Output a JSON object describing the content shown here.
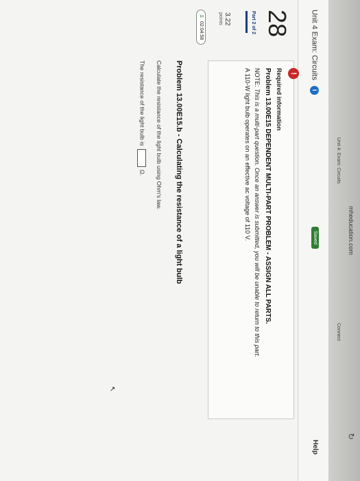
{
  "browser": {
    "url": "mheducation.com",
    "tabs": [
      "Unit 4: Exam: Circuits",
      "Connect"
    ]
  },
  "header": {
    "exam_title": "Unit 4 Exam: Circuits",
    "info_icon": "i",
    "saved_label": "Saved",
    "help_label": "Help"
  },
  "sidebar": {
    "question_number": "28",
    "part_label": "Part 2 of 2",
    "points_value": "3.22",
    "points_label": "points",
    "timer": "02:04:58"
  },
  "required_info": {
    "warning_icon": "!",
    "title": "Required information",
    "problem": "Problem 13.00E15 DEPENDENT MULTI-PART PROBLEM - ASSIGN ALL PARTS.",
    "note_prefix": "NOTE: ",
    "note_text": "This is a multi-part question. Once an answer is submitted, you will be unable to return to this part.",
    "description": "A 110-W light bulb operates on an effective ac voltage of 110 V."
  },
  "subproblem": {
    "title": "Problem 13.00E15.b - Calculating the resistance of a light bulb",
    "prompt": "Calculate the resistance of the light bulb using Ohm's law.",
    "answer_prefix": "The resistance of the light bulb is",
    "answer_value": "",
    "answer_unit": "Ω."
  },
  "icons": {
    "info": "info-icon",
    "warning": "warning-icon",
    "timer": "clock-icon",
    "reload": "reload-icon"
  },
  "colors": {
    "accent_blue": "#1b6ec2",
    "saved_green": "#2e7d32",
    "warning_red": "#c62828",
    "part_navy": "#1d3d7a"
  }
}
